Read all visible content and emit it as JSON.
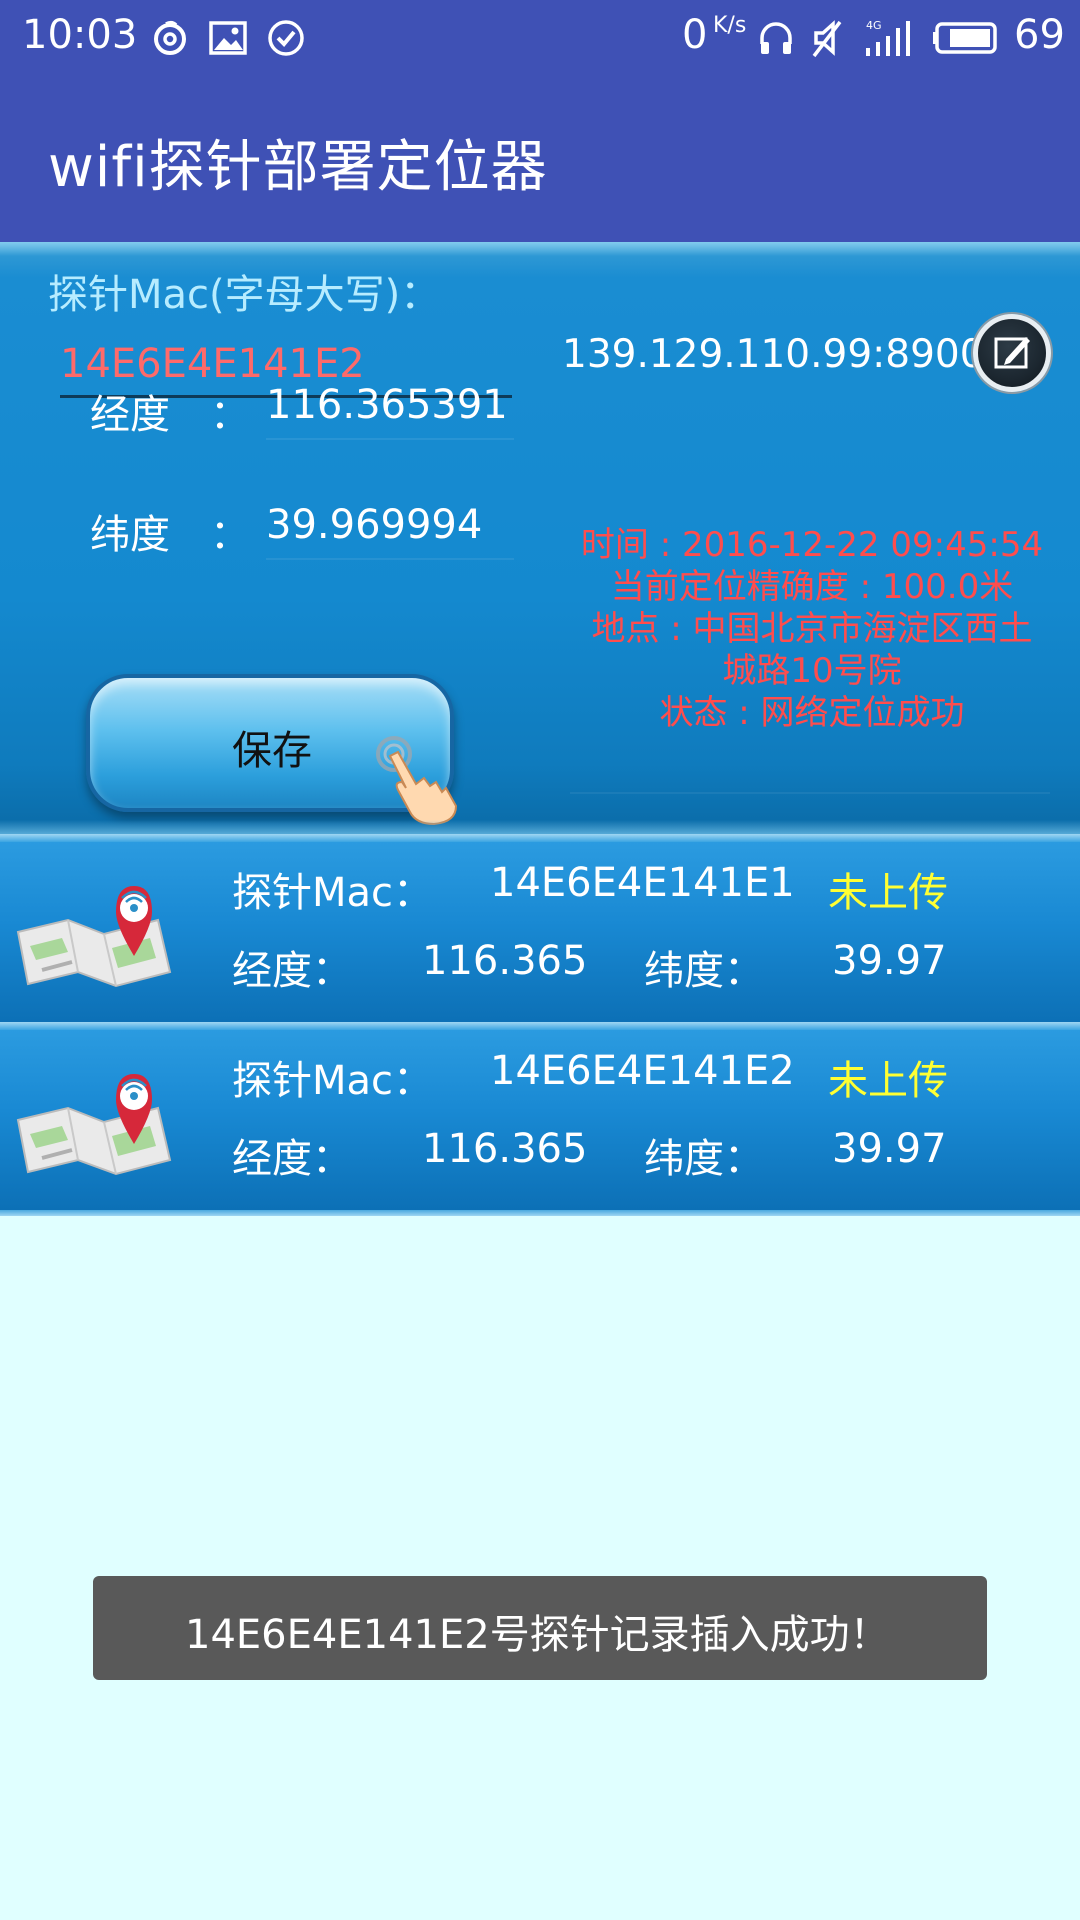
{
  "status_bar": {
    "time": "10:03",
    "speed_value": "0",
    "speed_unit": "K/s",
    "battery": "69",
    "icons": [
      "netease-music-icon",
      "image-icon",
      "check-circle-icon",
      "headphones-icon",
      "mute-icon",
      "signal-4g-icon",
      "battery-icon"
    ]
  },
  "app_bar": {
    "title": "wifi探针部署定位器"
  },
  "form": {
    "mac_label": "探针Mac(字母大写)：",
    "mac_value": "14E6E4E141E2",
    "server": "139.129.110.99:8900",
    "longitude_label": "经度",
    "latitude_label": "纬度",
    "colon": "：",
    "longitude_value": "116.365391",
    "latitude_value": "39.969994",
    "save_label": "保存"
  },
  "location_info": {
    "time": "时间 : 2016-12-22 09:45:54",
    "accuracy": "当前定位精确度 : 100.0米",
    "place_line1": "地点 : 中国北京市海淀区西土",
    "place_line2": "城路10号院",
    "state": "状态 : 网络定位成功"
  },
  "records": [
    {
      "mac_label": "探针Mac：",
      "mac": "14E6E4E141E1",
      "status": "未上传",
      "lng_label": "经度：",
      "lng": "116.365",
      "lat_label": "纬度：",
      "lat": "39.97"
    },
    {
      "mac_label": "探针Mac：",
      "mac": "14E6E4E141E2",
      "status": "未上传",
      "lng_label": "经度：",
      "lng": "116.365",
      "lat_label": "纬度：",
      "lat": "39.97"
    }
  ],
  "toast": {
    "message": "14E6E4E141E2号探针记录插入成功！"
  },
  "colors": {
    "primary": "#3f51b5",
    "panel_blue": "#1489cf",
    "warning_red": "#ff4d4d",
    "status_yellow": "#ffff33",
    "background": "#e0ffff"
  }
}
